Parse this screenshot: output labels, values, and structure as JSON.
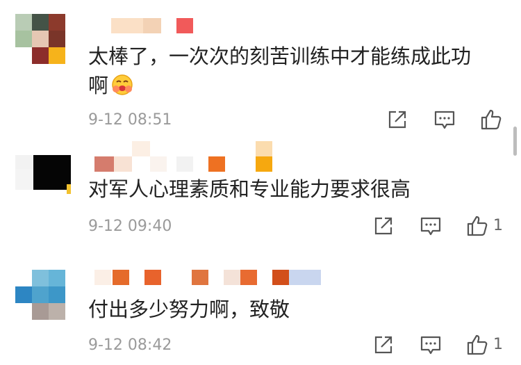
{
  "comments": [
    {
      "text_line1": "太棒了，一次次的刻苦训练中才能练成此功",
      "text_line2": "啊",
      "emoji": "blush-hug-emoji",
      "time": "9-12 08:51",
      "like_count": ""
    },
    {
      "text_line1": "对军人心理素质和专业能力要求很高",
      "time": "9-12 09:40",
      "like_count": "1"
    },
    {
      "text_line1": "付出多少努力啊，致敬",
      "time": "9-12 08:42",
      "like_count": "1"
    }
  ],
  "icons": {
    "share": "share-icon",
    "reply": "comment-icon",
    "like": "thumbs-up-icon"
  },
  "colors": {
    "text": "#222222",
    "time": "#9a9a9a",
    "icon": "#555555"
  }
}
